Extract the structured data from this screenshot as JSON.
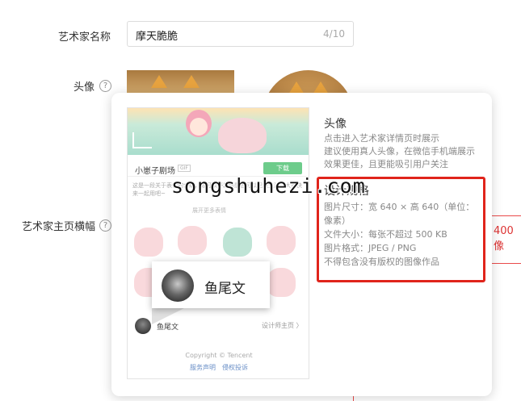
{
  "form": {
    "name_label": "艺术家名称",
    "name_value": "摩天脆脆",
    "name_count": "4/10",
    "avatar_label": "头像",
    "banner_label": "艺术家主页横幅",
    "help_glyph": "?",
    "banner_error_text": "400 像"
  },
  "popup": {
    "avatar_title": "头像",
    "avatar_desc": "点击进入艺术家详情页时展示\n建议使用真人头像，在微信手机端展示效果更佳，且更能吸引用户关注",
    "spec_title": "设计规格",
    "spec_lines": [
      "图片尺寸：宽 640 × 高 640（单位：像素）",
      "文件大小：每张不超过 500 KB",
      "图片格式：JPEG / PNG",
      "不得包含没有版权的图像作品"
    ]
  },
  "preview": {
    "pack_title": "小崽子剧场",
    "pack_tag": "GIF",
    "download_label": "下载",
    "description": "这是一段关于表情的介绍，即可以抒发情感也可以记录生活，大家快来一起用吧~",
    "more_label": "展开更多表情",
    "author_name": "鱼尾文",
    "author_link": "设计师主页 〉",
    "copyright": "Copyright © Tencent",
    "footer_links": "服务声明　侵权投诉",
    "callout_name": "鱼尾文"
  },
  "watermark": "songshuhezi.com"
}
